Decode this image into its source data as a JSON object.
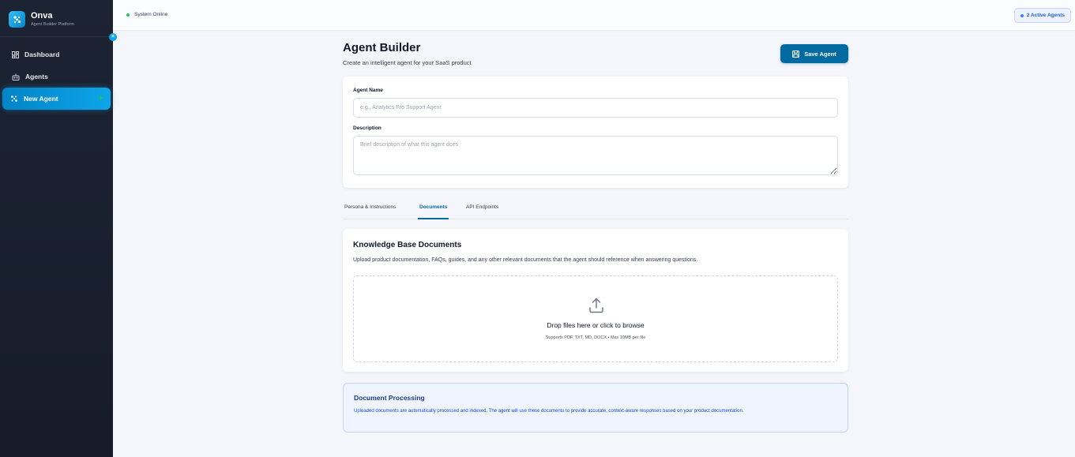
{
  "brand": {
    "name": "Onva",
    "tagline": "Agent Builder Platform"
  },
  "sidebar": {
    "items": [
      {
        "label": "Dashboard",
        "icon": "dashboard-icon"
      },
      {
        "label": "Agents",
        "icon": "bot-icon"
      },
      {
        "label": "New Agent",
        "icon": "sparkle-icon",
        "active": true
      }
    ]
  },
  "topbar": {
    "status": "System Online",
    "active_agents": "2 Active Agents"
  },
  "page": {
    "title": "Agent Builder",
    "subtitle": "Create an intelligent agent for your SaaS product",
    "save_label": "Save Agent"
  },
  "form": {
    "name_label": "Agent Name",
    "name_value": "",
    "name_placeholder": "e.g., Analytics Pro Support Agent",
    "description_label": "Description",
    "description_value": "",
    "description_placeholder": "Brief description of what this agent does"
  },
  "tabs": [
    {
      "label": "Persona & Instructions",
      "active": false
    },
    {
      "label": "Documents",
      "active": true
    },
    {
      "label": "API Endpoints",
      "active": false
    }
  ],
  "documents": {
    "title": "Knowledge Base Documents",
    "description": "Upload product documentation, FAQs, guides, and any other relevant documents that the agent should reference when answering questions.",
    "drop_text": "Drop files here or click to browse",
    "drop_hint": "Supports PDF, TXT, MD, DOCX • Max 10MB per file"
  },
  "processing": {
    "title": "Document Processing",
    "text": "Uploaded documents are automatically processed and indexed. The agent will use these documents to provide accurate, context-aware responses based on your product documentation."
  },
  "colors": {
    "accent": "#0369a1",
    "sidebar_bg": "#1c2333",
    "status_green": "#22c55e"
  }
}
